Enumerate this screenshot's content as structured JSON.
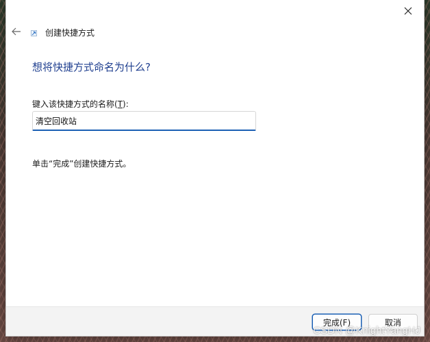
{
  "window": {
    "close_icon": "close-icon"
  },
  "header": {
    "back_icon": "back-arrow-icon",
    "wizard_icon": "shortcut-icon",
    "title": "创建快捷方式"
  },
  "main": {
    "heading": "想将快捷方式命名为什么?",
    "field_label_prefix": "键入该快捷方式的名称(",
    "field_label_key": "T",
    "field_label_suffix": "):",
    "name_value": "清空回收站",
    "instruction": "单击“完成”创建快捷方式。"
  },
  "footer": {
    "finish_label": "完成(F)",
    "cancel_label": "取消"
  },
  "watermark": "CSDN @KnightYangHJ",
  "colors": {
    "heading": "#1f3f8f",
    "accent": "#1a5fb4"
  }
}
